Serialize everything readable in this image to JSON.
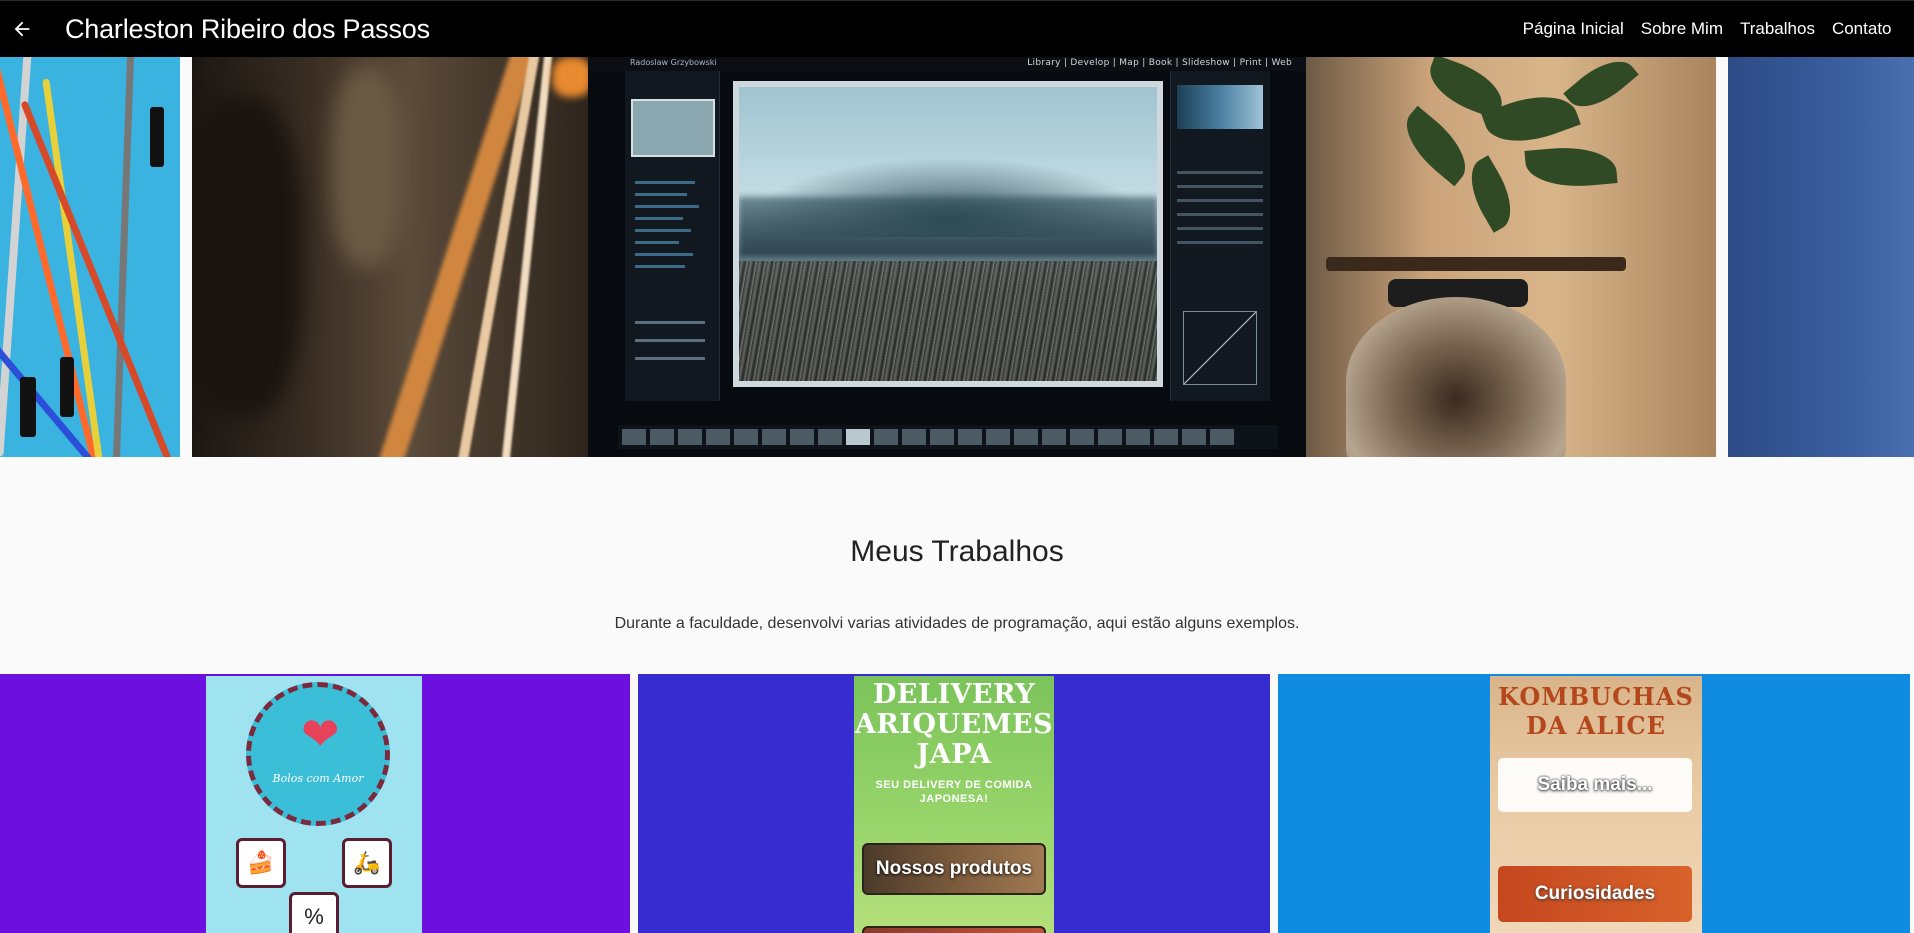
{
  "app": {
    "title": "Charleston Ribeiro dos Passos",
    "back_icon": "arrow-left-icon"
  },
  "nav": {
    "items": [
      {
        "label": "Página Inicial"
      },
      {
        "label": "Sobre Mim"
      },
      {
        "label": "Trabalhos"
      },
      {
        "label": "Contato"
      }
    ]
  },
  "carousel": {
    "monitor": {
      "user": "Radoslaw Grzybowski",
      "menu": "Library | Develop | Map | Book | Slideshow | Print | Web"
    }
  },
  "section": {
    "title": "Meus Trabalhos",
    "description": "Durante a faculdade, desenvolvi varias atividades de programação, aqui estão alguns exemplos."
  },
  "cards": [
    {
      "bg_color": "#6b10de",
      "cake_label": "Bolos com Amor"
    },
    {
      "bg_color": "#372ccf",
      "title": "DELIVERY ARIQUEMES JAPA",
      "subtitle": "SEU DELIVERY DE COMIDA JAPONESA!",
      "button": "Nossos produtos"
    },
    {
      "bg_color": "#0f8be2",
      "title": "KOMBUCHAS DA ALICE",
      "button_1": "Saiba mais...",
      "button_2": "Curiosidades"
    }
  ],
  "colors": {
    "appbar": "#000000",
    "page_bg": "#fafafa"
  }
}
